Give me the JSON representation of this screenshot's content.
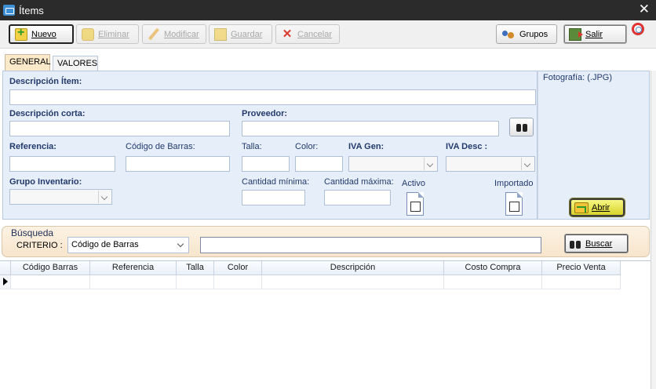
{
  "window": {
    "title": "Ítems",
    "close_glyph": "✕"
  },
  "toolbar": {
    "nuevo": "Nuevo",
    "eliminar": "Eliminar",
    "modificar": "Modificar",
    "guardar": "Guardar",
    "cancelar": "Cancelar",
    "grupos": "Grupos",
    "salir": "Salir"
  },
  "tabs": [
    {
      "label": "GENERAL",
      "active": true
    },
    {
      "label": "VALORES",
      "active": false
    }
  ],
  "general": {
    "descripcion_item": "Descripción Ítem:",
    "descripcion_corta": "Descripción corta:",
    "proveedor": "Proveedor:",
    "referencia": "Referencia:",
    "codigo_barras": "Código de Barras:",
    "talla": "Talla:",
    "color": "Color:",
    "iva_gen": "IVA Gen:",
    "iva_desc": "IVA Desc :",
    "grupo_inventario": "Grupo Inventario:",
    "cantidad_minima": "Cantidad mínima:",
    "cantidad_maxima": "Cantidad máxima:",
    "activo": "Activo",
    "importado": "Importado"
  },
  "photo": {
    "title": "Fotografía: (.JPG)",
    "abrir": "Abrir"
  },
  "search": {
    "title": "Búsqueda",
    "criterio_label": "CRITERIO :",
    "criterio_value": "Código de Barras",
    "query_value": "",
    "buscar": "Buscar"
  },
  "grid": {
    "columns": [
      "Código Barras",
      "Referencia",
      "Talla",
      "Color",
      "Descripción",
      "Costo Compra",
      "Precio Venta"
    ]
  },
  "icons": {
    "app": "app-window-icon",
    "nuevo": "new-document-icon",
    "eliminar": "delete-icon",
    "modificar": "pencil-icon",
    "guardar": "save-icon",
    "cancelar": "cancel-x-icon",
    "grupos": "group-users-icon",
    "salir": "exit-door-icon",
    "help": "lifebuoy-help-icon",
    "proveedor_search": "binoculars-icon",
    "abrir": "open-folder-icon",
    "buscar": "binoculars-icon"
  },
  "colors": {
    "titlebar": "#2b2b2b",
    "panel": "#e6eef9",
    "label_blue": "#223a6c",
    "tab_active": "#fbe9c9",
    "search_bg": "#fcf2e3",
    "abrir_button": "#e8e65a"
  }
}
